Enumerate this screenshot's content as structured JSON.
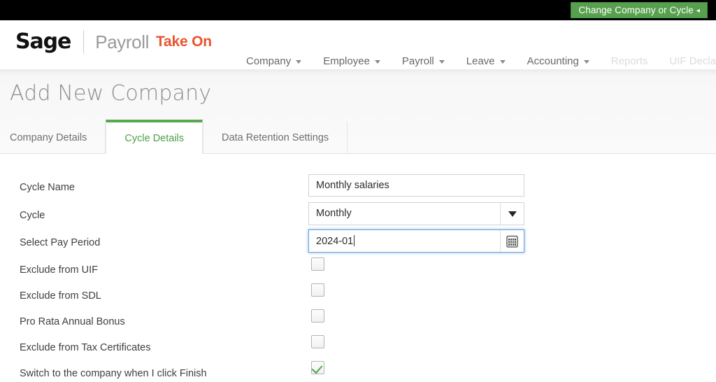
{
  "topbar": {
    "change_cycle_label": "Change Company or Cycle",
    "change_cycle_caret": "◂",
    "background": "#000000",
    "button_color": "#57a04e"
  },
  "branding": {
    "logo": "Sage",
    "product": "Payroll",
    "suffix": "Take On",
    "suffix_color": "#e8542f"
  },
  "nav": {
    "items": [
      {
        "label": "Company",
        "has_caret": true,
        "disabled": false
      },
      {
        "label": "Employee",
        "has_caret": true,
        "disabled": false
      },
      {
        "label": "Payroll",
        "has_caret": true,
        "disabled": false
      },
      {
        "label": "Leave",
        "has_caret": true,
        "disabled": false
      },
      {
        "label": "Accounting",
        "has_caret": true,
        "disabled": false
      },
      {
        "label": "Reports",
        "has_caret": false,
        "disabled": true
      },
      {
        "label": "UIF Declar",
        "has_caret": false,
        "disabled": true
      }
    ]
  },
  "page": {
    "title": "Add New Company"
  },
  "tabs": [
    {
      "label": "Company Details",
      "active": false
    },
    {
      "label": "Cycle Details",
      "active": true
    },
    {
      "label": "Data Retention Settings",
      "active": false
    }
  ],
  "accent_color": "#56a94f",
  "form": {
    "fields": [
      {
        "label": "Cycle Name",
        "type": "text",
        "value": "Monthly salaries"
      },
      {
        "label": "Cycle",
        "type": "select",
        "value": "Monthly"
      },
      {
        "label": "Select Pay Period",
        "type": "date",
        "value": "2024-01",
        "focused": true,
        "icon": "calendar-icon"
      },
      {
        "label": "Exclude from UIF",
        "type": "checkbox",
        "checked": false
      },
      {
        "label": "Exclude from SDL",
        "type": "checkbox",
        "checked": false
      },
      {
        "label": "Pro Rata Annual Bonus",
        "type": "checkbox",
        "checked": false
      },
      {
        "label": "Exclude from Tax Certificates",
        "type": "checkbox",
        "checked": false
      },
      {
        "label": "Switch to the company when I click Finish",
        "type": "checkbox",
        "checked": true
      }
    ]
  }
}
